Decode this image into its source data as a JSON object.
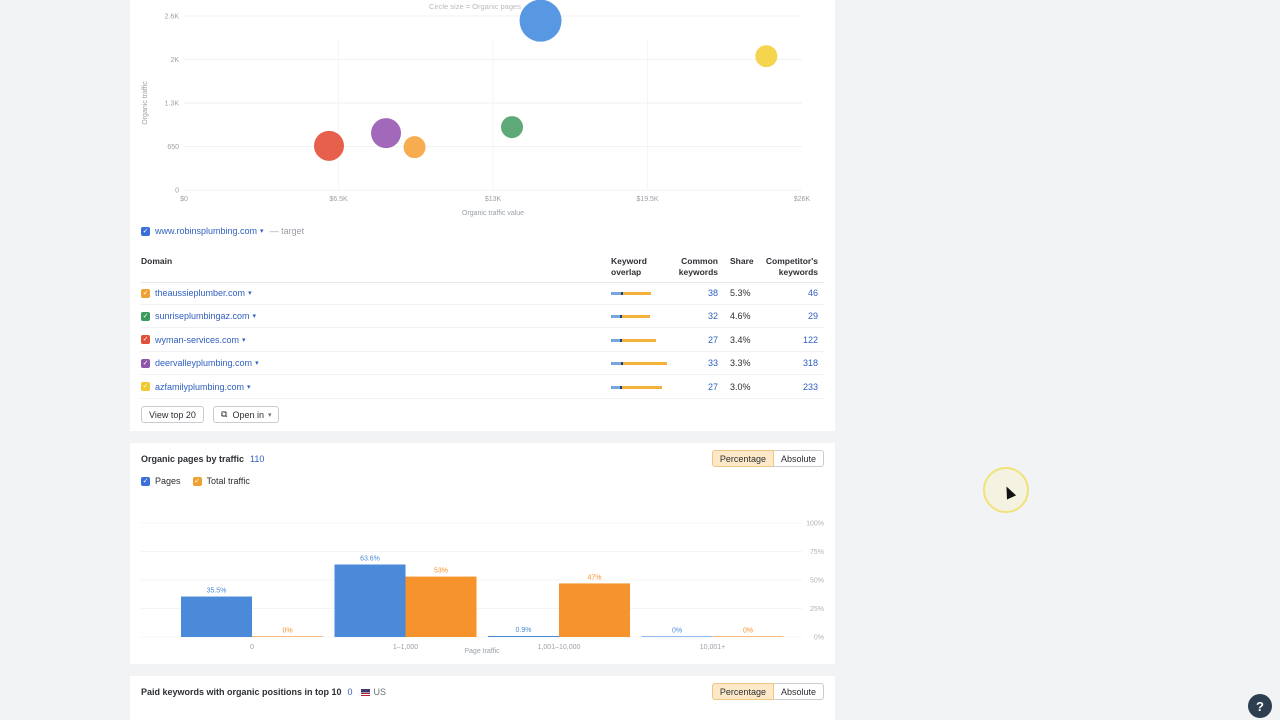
{
  "bubble_chart": {
    "caption": "Circle size = Organic pages",
    "y_axis_label": "Organic traffic",
    "x_axis_label": "Organic traffic value",
    "chart_data": {
      "type": "scatter",
      "xlabel": "Organic traffic value",
      "ylabel": "Organic traffic",
      "x_ticks": [
        "$0",
        "$6.5K",
        "$13K",
        "$19.5K",
        "$26K"
      ],
      "y_ticks": [
        "0",
        "650",
        "1.3K",
        "2K",
        "2.6K"
      ],
      "xlim": [
        0,
        26000
      ],
      "ylim": [
        0,
        2600
      ],
      "series": [
        {
          "domain": "www.robinsplumbing.com",
          "x": 15000,
          "y": 2530,
          "size": "large",
          "color": "#4a8fe0"
        },
        {
          "domain": "theaussieplumber.com",
          "x": 9700,
          "y": 640,
          "size": "small",
          "color": "#f7a541"
        },
        {
          "domain": "sunriseplumbingaz.com",
          "x": 13800,
          "y": 940,
          "size": "small",
          "color": "#4fa36d"
        },
        {
          "domain": "wyman-services.com",
          "x": 6100,
          "y": 660,
          "size": "medium",
          "color": "#e5533d"
        },
        {
          "domain": "deervalleyplumbing.com",
          "x": 8500,
          "y": 850,
          "size": "medium",
          "color": "#9a5cb4"
        },
        {
          "domain": "azfamilyplumbing.com",
          "x": 24500,
          "y": 2000,
          "size": "small",
          "color": "#f4d03f"
        }
      ]
    }
  },
  "target": {
    "domain": "www.robinsplumbing.com",
    "suffix": "— target"
  },
  "competitors_table": {
    "headers": {
      "domain": "Domain",
      "overlap": [
        "Keyword",
        "overlap"
      ],
      "common": [
        "Common",
        "keywords"
      ],
      "share": "Share",
      "competitor": [
        "Competitor's",
        "keywords"
      ]
    },
    "rows": [
      {
        "domain": "theaussieplumber.com",
        "color": "#f0a030",
        "common": "38",
        "share": "5.3%",
        "competitor": "46",
        "bar_total": 40
      },
      {
        "domain": "sunriseplumbingaz.com",
        "color": "#3d9a5f",
        "common": "32",
        "share": "4.6%",
        "competitor": "29",
        "bar_total": 39
      },
      {
        "domain": "wyman-services.com",
        "color": "#e0503a",
        "common": "27",
        "share": "3.4%",
        "competitor": "122",
        "bar_total": 45
      },
      {
        "domain": "deervalleyplumbing.com",
        "color": "#8e55a8",
        "common": "33",
        "share": "3.3%",
        "competitor": "318",
        "bar_total": 56
      },
      {
        "domain": "azfamilyplumbing.com",
        "color": "#f0c830",
        "common": "27",
        "share": "3.0%",
        "competitor": "233",
        "bar_total": 51
      }
    ],
    "view_button": "View top 20",
    "open_button": "Open in"
  },
  "organic_pages": {
    "title": "Organic pages by traffic",
    "count": "110",
    "toggle": {
      "percentage": "Percentage",
      "absolute": "Absolute"
    },
    "legend": {
      "pages": "Pages",
      "traffic": "Total traffic"
    },
    "chart_data": {
      "type": "bar",
      "xlabel": "Page traffic",
      "categories": [
        "0",
        "1–1,000",
        "1,001–10,000",
        "10,001+"
      ],
      "y_ticks": [
        "100%",
        "75%",
        "50%",
        "25%",
        "0%"
      ],
      "ylim": [
        0,
        100
      ],
      "series": [
        {
          "name": "Pages",
          "values": [
            35.5,
            63.6,
            0.9,
            0
          ],
          "labels": [
            "35.5%",
            "63.6%",
            "0.9%",
            "0%"
          ],
          "color": "#4a8ad8"
        },
        {
          "name": "Total traffic",
          "values": [
            0,
            53,
            47,
            0
          ],
          "labels": [
            "0%",
            "53%",
            "47%",
            "0%"
          ],
          "color": "#f7932c"
        }
      ]
    }
  },
  "paid_keywords": {
    "title": "Paid keywords with organic positions in top 10",
    "count": "0",
    "region": "US",
    "toggle": {
      "percentage": "Percentage",
      "absolute": "Absolute"
    }
  },
  "help": {
    "icon": "?"
  }
}
